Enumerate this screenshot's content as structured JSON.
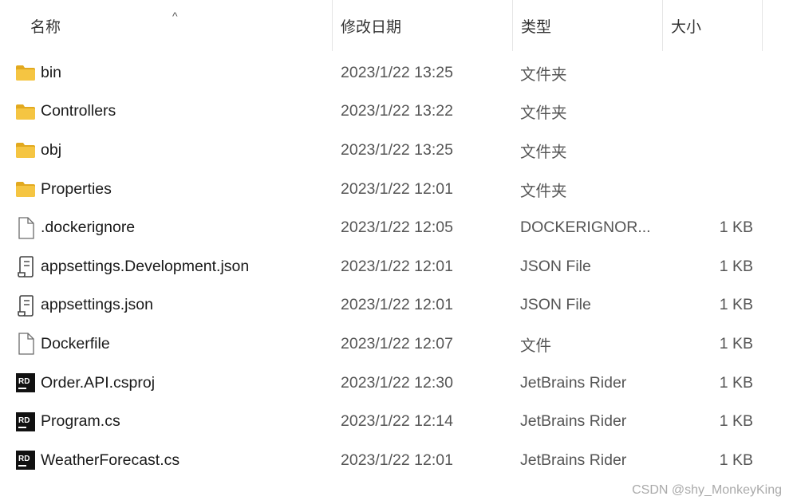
{
  "header": {
    "name": "名称",
    "date": "修改日期",
    "type": "类型",
    "size": "大小"
  },
  "files": [
    {
      "icon": "folder-icon",
      "name": "bin",
      "date": "2023/1/22 13:25",
      "type": "文件夹",
      "size": ""
    },
    {
      "icon": "folder-icon",
      "name": "Controllers",
      "date": "2023/1/22 13:22",
      "type": "文件夹",
      "size": ""
    },
    {
      "icon": "folder-icon",
      "name": "obj",
      "date": "2023/1/22 13:25",
      "type": "文件夹",
      "size": ""
    },
    {
      "icon": "folder-icon",
      "name": "Properties",
      "date": "2023/1/22 12:01",
      "type": "文件夹",
      "size": ""
    },
    {
      "icon": "file-icon",
      "name": ".dockerignore",
      "date": "2023/1/22 12:05",
      "type": "DOCKERIGNOR...",
      "size": "1 KB"
    },
    {
      "icon": "json-file-icon",
      "name": "appsettings.Development.json",
      "date": "2023/1/22 12:01",
      "type": "JSON File",
      "size": "1 KB"
    },
    {
      "icon": "json-file-icon",
      "name": "appsettings.json",
      "date": "2023/1/22 12:01",
      "type": "JSON File",
      "size": "1 KB"
    },
    {
      "icon": "file-icon",
      "name": "Dockerfile",
      "date": "2023/1/22 12:07",
      "type": "文件",
      "size": "1 KB"
    },
    {
      "icon": "rider-icon",
      "name": "Order.API.csproj",
      "date": "2023/1/22 12:30",
      "type": "JetBrains Rider",
      "size": "1 KB"
    },
    {
      "icon": "rider-icon",
      "name": "Program.cs",
      "date": "2023/1/22 12:14",
      "type": "JetBrains Rider",
      "size": "1 KB"
    },
    {
      "icon": "rider-icon",
      "name": "WeatherForecast.cs",
      "date": "2023/1/22 12:01",
      "type": "JetBrains Rider",
      "size": "1 KB"
    }
  ],
  "icons": {
    "rider_label": "RD"
  },
  "colors": {
    "folder": "#f5c542",
    "folder_dark": "#e2a91f",
    "rider_bg": "#111111"
  },
  "watermark": "CSDN @shy_MonkeyKing"
}
